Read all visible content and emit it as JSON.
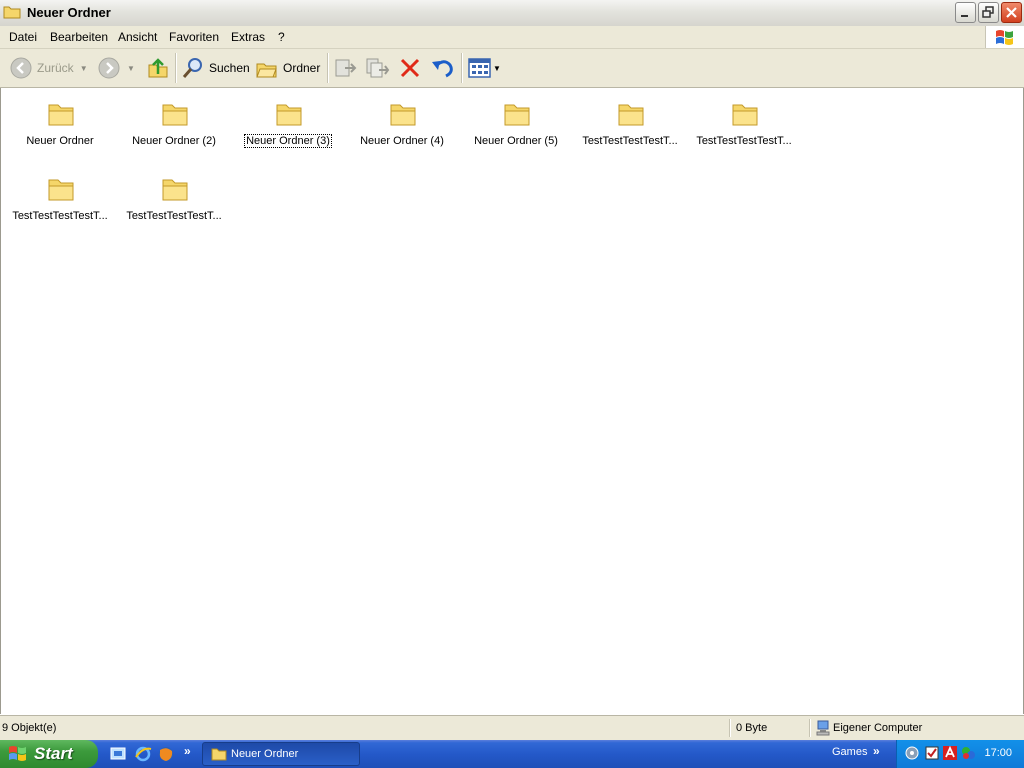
{
  "window": {
    "title": "Neuer Ordner"
  },
  "menu": {
    "items": [
      "Datei",
      "Bearbeiten",
      "Ansicht",
      "Favoriten",
      "Extras",
      "?"
    ]
  },
  "toolbar": {
    "back_label": "Zurück",
    "search_label": "Suchen",
    "folders_label": "Ordner"
  },
  "files": [
    {
      "name": "Neuer Ordner",
      "selected": false
    },
    {
      "name": "Neuer Ordner (2)",
      "selected": false
    },
    {
      "name": "Neuer Ordner (3)",
      "selected": true
    },
    {
      "name": "Neuer Ordner (4)",
      "selected": false
    },
    {
      "name": "Neuer Ordner (5)",
      "selected": false
    },
    {
      "name": "TestTestTestTestT...",
      "selected": false
    },
    {
      "name": "TestTestTestTestT...",
      "selected": false
    },
    {
      "name": "TestTestTestTestT...",
      "selected": false
    },
    {
      "name": "TestTestTestTestT...",
      "selected": false
    }
  ],
  "status": {
    "count": "9 Objekt(e)",
    "size": "0 Byte",
    "location": "Eigener Computer"
  },
  "taskbar": {
    "start_label": "Start",
    "task_label": "Neuer Ordner",
    "toolbar_label": "Games",
    "clock": "17:00"
  },
  "colors": {
    "taskbar_blue": "#2459c9",
    "start_green": "#3c9a3c",
    "tray_blue": "#1290e9",
    "folder_yellow": "#f5d66a"
  }
}
